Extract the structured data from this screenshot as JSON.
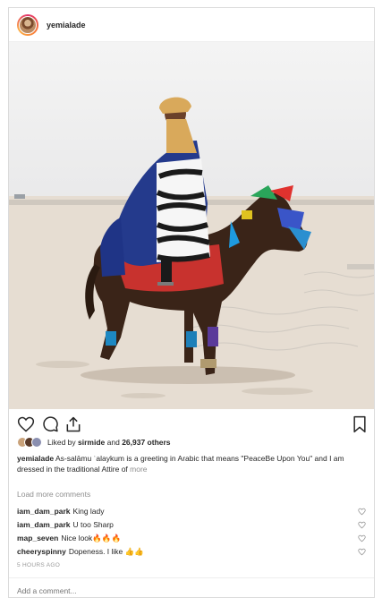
{
  "post": {
    "username": "yemialade",
    "likes": {
      "prefix": "Liked by ",
      "user": "sirmide",
      "middle": " and ",
      "count": "26,937 others"
    },
    "caption": {
      "user": "yemialade",
      "text": " As-salāmu ʿalaykum is a greeting in Arabic that means \"PeaceBe Upon You\" and I am dressed in the traditional Attire of ",
      "more": "more"
    },
    "load_more": "Load more comments",
    "comments": [
      {
        "user": "iam_dam_park",
        "text": "King lady"
      },
      {
        "user": "iam_dam_park",
        "text": "U too Sharp"
      },
      {
        "user": "map_seven",
        "text": "Nice look🔥🔥🔥"
      },
      {
        "user": "cheeryspinny",
        "text": "Dopeness. I like 👍👍"
      }
    ],
    "timestamp": "5 HOURS AGO",
    "add_comment_placeholder": "Add a comment..."
  },
  "icons": [
    "heart-icon",
    "comment-icon",
    "share-icon",
    "bookmark-icon"
  ],
  "colors": {
    "text": "#262626",
    "muted": "#8e8e8e",
    "border": "#dbdbdb"
  }
}
